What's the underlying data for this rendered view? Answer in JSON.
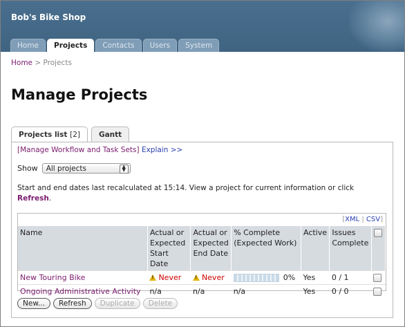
{
  "header": {
    "brand": "Bob's Bike Shop"
  },
  "nav_tabs": [
    {
      "label": "Home"
    },
    {
      "label": "Projects",
      "active": true
    },
    {
      "label": "Contacts"
    },
    {
      "label": "Users"
    },
    {
      "label": "System"
    }
  ],
  "breadcrumb": {
    "home": "Home",
    "sep": ">",
    "current": "Projects"
  },
  "page_title": "Manage Projects",
  "subtabs": {
    "list_label": "Projects list",
    "list_count": "[2]",
    "gantt_label": "Gantt"
  },
  "links": {
    "manage": "[Manage Workflow and Task Sets]",
    "explain": "Explain >>"
  },
  "filter": {
    "label": "Show",
    "selected": "All projects"
  },
  "note": {
    "text": "Start and end dates last recalculated at 15:14. View a project for current information or click",
    "link": "Refresh",
    "end": "."
  },
  "export": {
    "xml": "XML",
    "sep": "|",
    "csv": "CSV"
  },
  "table": {
    "headers": [
      "Name",
      "Actual or Expected Start Date",
      "Actual or Expected End Date",
      "% Complete (Expected Work)",
      "Active",
      "Issues Complete"
    ],
    "rows": [
      {
        "name": "New Touring Bike",
        "start": "Never",
        "end": "Never",
        "complete": "0%",
        "progress": 0,
        "active": "Yes",
        "issues": "0 / 1"
      },
      {
        "name": "Ongoing Administrative Activity",
        "start": "n/a",
        "end": "n/a",
        "complete": "n/a",
        "active": "Yes",
        "issues": "0 / 0"
      }
    ]
  },
  "buttons": {
    "new": "New...",
    "refresh": "Refresh",
    "duplicate": "Duplicate",
    "delete": "Delete"
  },
  "colors": {
    "header": "#4a6f8e",
    "link": "#7a1b6e",
    "accent_blue": "#2a3fb0",
    "warning": "#cc0000"
  }
}
